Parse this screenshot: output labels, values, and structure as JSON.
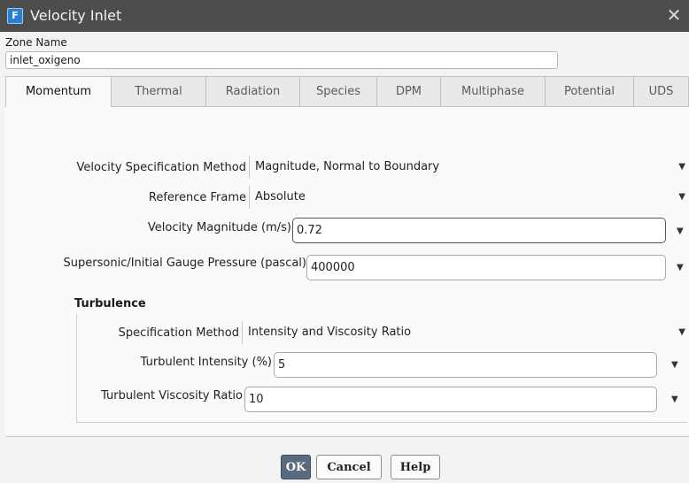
{
  "window": {
    "title": "Velocity Inlet",
    "close_label": "✕",
    "app_icon": "F"
  },
  "zone": {
    "label": "Zone Name",
    "value": "inlet_oxigeno"
  },
  "tabs": [
    {
      "label": "Momentum",
      "active": true
    },
    {
      "label": "Thermal"
    },
    {
      "label": "Radiation"
    },
    {
      "label": "Species"
    },
    {
      "label": "DPM"
    },
    {
      "label": "Multiphase"
    },
    {
      "label": "Potential"
    },
    {
      "label": "UDS"
    }
  ],
  "momentum": {
    "velocity_spec": {
      "label": "Velocity Specification Method",
      "value": "Magnitude, Normal to Boundary"
    },
    "reference_frame": {
      "label": "Reference Frame",
      "value": "Absolute"
    },
    "velocity_magnitude": {
      "label": "Velocity Magnitude (m/s)",
      "value": "0.72"
    },
    "gauge_pressure": {
      "label": "Supersonic/Initial Gauge Pressure (pascal)",
      "value": "400000"
    },
    "turbulence": {
      "title": "Turbulence",
      "spec_method": {
        "label": "Specification Method",
        "value": "Intensity and Viscosity Ratio"
      },
      "intensity": {
        "label": "Turbulent Intensity (%)",
        "value": "5"
      },
      "viscosity_ratio": {
        "label": "Turbulent Viscosity Ratio",
        "value": "10"
      }
    }
  },
  "buttons": {
    "ok": "OK",
    "cancel": "Cancel",
    "help": "Help"
  },
  "icons": {
    "dropdown": "chevron-down-icon",
    "close": "close-icon"
  },
  "colors": {
    "titlebar": "#4d4d4d",
    "app_icon": "#2a7fd4",
    "ok_button": "#5a6b80"
  }
}
